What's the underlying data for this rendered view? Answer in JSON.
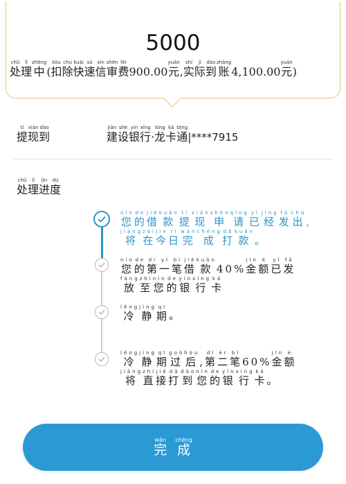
{
  "summary": {
    "amount": "5000",
    "status": [
      {
        "hz": "处",
        "py": "chǔ"
      },
      {
        "hz": "理",
        "py": "lǐ"
      },
      {
        "hz": "中",
        "py": "zhōng"
      },
      {
        "hz": "(",
        "py": ""
      },
      {
        "hz": "扣",
        "py": "kòu"
      },
      {
        "hz": "除",
        "py": "chú"
      },
      {
        "hz": "快",
        "py": "kuài"
      },
      {
        "hz": "速",
        "py": "sù"
      },
      {
        "hz": "信",
        "py": "xìn"
      },
      {
        "hz": "审",
        "py": "shěn"
      },
      {
        "hz": "费",
        "py": "fèi"
      },
      {
        "hz": "900.00",
        "py": ""
      },
      {
        "hz": "元",
        "py": "yuán"
      },
      {
        "hz": ",",
        "py": ""
      },
      {
        "hz": "实",
        "py": "shí"
      },
      {
        "hz": "际",
        "py": "jì"
      },
      {
        "hz": "到",
        "py": "dào"
      },
      {
        "hz": "账",
        "py": "zhàng"
      },
      {
        "hz": "4,100.00",
        "py": ""
      },
      {
        "hz": "元",
        "py": "yuán"
      },
      {
        "hz": ")",
        "py": ""
      }
    ]
  },
  "withdraw": {
    "label": [
      {
        "hz": "提",
        "py": "tí"
      },
      {
        "hz": "现",
        "py": "xiàn"
      },
      {
        "hz": "到",
        "py": "dào"
      }
    ],
    "bank": [
      {
        "hz": "建",
        "py": "jiàn"
      },
      {
        "hz": "设",
        "py": "shè"
      },
      {
        "hz": "银",
        "py": "yín"
      },
      {
        "hz": "行",
        "py": "xíng"
      },
      {
        "hz": "·",
        "py": ""
      },
      {
        "hz": "龙",
        "py": "lóng"
      },
      {
        "hz": "卡",
        "py": "kǎ"
      },
      {
        "hz": "通",
        "py": "tōng"
      }
    ],
    "card_suffix": "|****7915"
  },
  "progress": {
    "title": [
      {
        "hz": "处",
        "py": "chǔ"
      },
      {
        "hz": "理",
        "py": "lǐ"
      },
      {
        "hz": "进",
        "py": "jìn"
      },
      {
        "hz": "度",
        "py": "dù"
      }
    ],
    "steps": [
      {
        "state": "active",
        "lines": [
          [
            {
              "hz": "您",
              "py": "nín"
            },
            {
              "hz": "的",
              "py": "de"
            },
            {
              "hz": "借",
              "py": "jiè"
            },
            {
              "hz": "款",
              "py": "kuǎn"
            },
            {
              "hz": "提",
              "py": "tí"
            },
            {
              "hz": "现",
              "py": "xiàn"
            },
            {
              "hz": "申",
              "py": "shēn"
            },
            {
              "hz": "请",
              "py": "qǐng"
            },
            {
              "hz": "已",
              "py": "yǐ"
            },
            {
              "hz": "经",
              "py": "jīng"
            },
            {
              "hz": "发",
              "py": "fā"
            },
            {
              "hz": "出",
              "py": "chū"
            },
            {
              "hz": ",",
              "py": ""
            }
          ],
          [
            {
              "hz": "将",
              "py": "jiāng"
            },
            {
              "hz": "在",
              "py": "zài"
            },
            {
              "hz": "今",
              "py": "jīn"
            },
            {
              "hz": "日",
              "py": "rì"
            },
            {
              "hz": "完",
              "py": "wán"
            },
            {
              "hz": "成",
              "py": "chéng"
            },
            {
              "hz": "打",
              "py": "dǎ"
            },
            {
              "hz": "款",
              "py": "kuǎn"
            },
            {
              "hz": "。",
              "py": ""
            }
          ]
        ]
      },
      {
        "state": "done",
        "lines": [
          [
            {
              "hz": "您",
              "py": "nín"
            },
            {
              "hz": "的",
              "py": "de"
            },
            {
              "hz": "第",
              "py": "dì"
            },
            {
              "hz": "一",
              "py": "yī"
            },
            {
              "hz": "笔",
              "py": "bǐ"
            },
            {
              "hz": "借",
              "py": "jiè"
            },
            {
              "hz": "款",
              "py": "kuǎn"
            },
            {
              "hz": "40%",
              "py": ""
            },
            {
              "hz": "金",
              "py": "jīn"
            },
            {
              "hz": "额",
              "py": "é"
            },
            {
              "hz": "已",
              "py": "yǐ"
            },
            {
              "hz": "发",
              "py": "fā"
            }
          ],
          [
            {
              "hz": "放",
              "py": "fàng"
            },
            {
              "hz": "至",
              "py": "zhì"
            },
            {
              "hz": "您",
              "py": "nín"
            },
            {
              "hz": "的",
              "py": "de"
            },
            {
              "hz": "银",
              "py": "yín"
            },
            {
              "hz": "行",
              "py": "xíng"
            },
            {
              "hz": "卡",
              "py": "kǎ"
            }
          ]
        ]
      },
      {
        "state": "done",
        "lines": [
          [
            {
              "hz": "冷",
              "py": "lěng"
            },
            {
              "hz": "静",
              "py": "jìng"
            },
            {
              "hz": "期",
              "py": "qī"
            },
            {
              "hz": "。",
              "py": ""
            }
          ]
        ]
      },
      {
        "state": "done",
        "lines": [
          [
            {
              "hz": "冷",
              "py": "lěng"
            },
            {
              "hz": "静",
              "py": "jìng"
            },
            {
              "hz": "期",
              "py": "qī"
            },
            {
              "hz": "过",
              "py": "guò"
            },
            {
              "hz": "后",
              "py": "hòu"
            },
            {
              "hz": ",",
              "py": ""
            },
            {
              "hz": "第",
              "py": "dì"
            },
            {
              "hz": "二",
              "py": "èr"
            },
            {
              "hz": "笔",
              "py": "bǐ"
            },
            {
              "hz": "60%",
              "py": ""
            },
            {
              "hz": "金",
              "py": "jīn"
            },
            {
              "hz": "额",
              "py": "é"
            }
          ],
          [
            {
              "hz": "将",
              "py": "jiāng"
            },
            {
              "hz": "直",
              "py": "zhí"
            },
            {
              "hz": "接",
              "py": "jiē"
            },
            {
              "hz": "打",
              "py": "dǎ"
            },
            {
              "hz": "到",
              "py": "dào"
            },
            {
              "hz": "您",
              "py": "nín"
            },
            {
              "hz": "的",
              "py": "de"
            },
            {
              "hz": "银",
              "py": "yín"
            },
            {
              "hz": "行",
              "py": "xíng"
            },
            {
              "hz": "卡",
              "py": "kǎ"
            },
            {
              "hz": "。",
              "py": ""
            }
          ]
        ]
      }
    ]
  },
  "button": {
    "label": [
      {
        "hz": "完",
        "py": "wán"
      },
      {
        "hz": "成",
        "py": "chéng"
      }
    ]
  },
  "colors": {
    "accent": "#2a93c9",
    "button": "#2b9ad4",
    "card_border": "#e6c46a",
    "inactive": "#b8b8b8"
  },
  "icons": {
    "active_step": "check-circle-icon",
    "done_step": "check-circle-icon"
  }
}
